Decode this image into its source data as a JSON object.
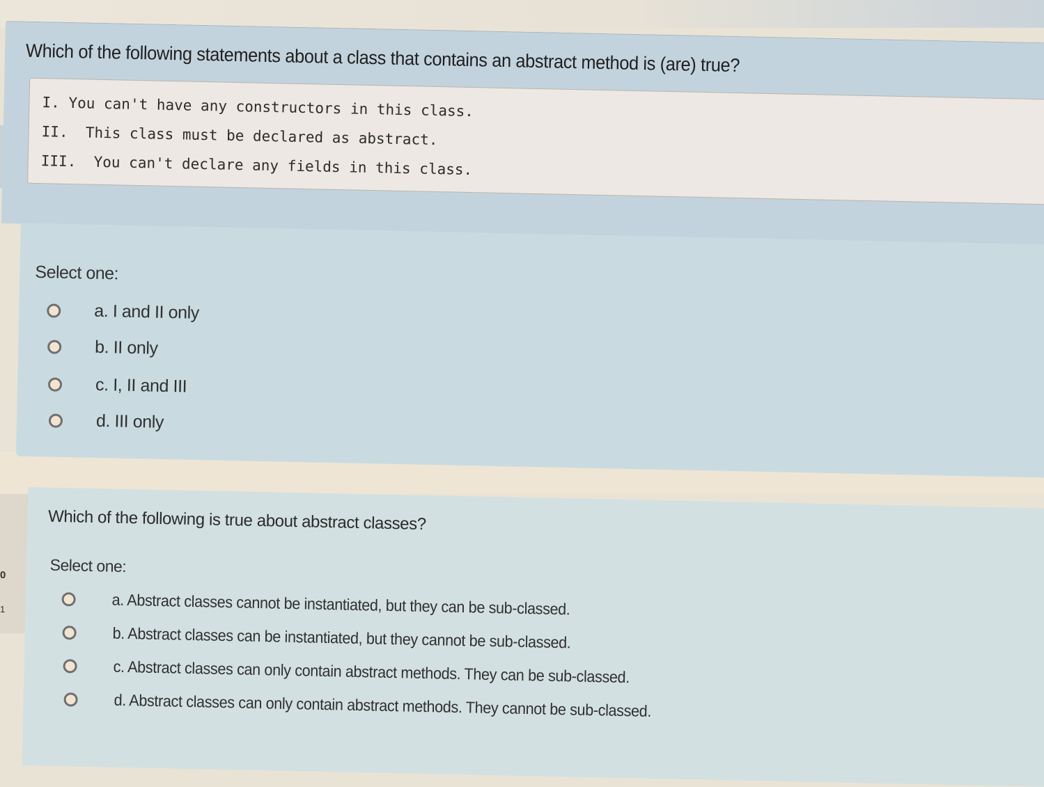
{
  "question1": {
    "prompt": "Which of the following statements about a class that contains an abstract method is (are) true?",
    "statements": [
      "I. You can't have any constructors in this class.",
      "II.  This class must be declared as abstract.",
      "III.  You can't declare any fields in this class."
    ],
    "select_label": "Select one:",
    "options": [
      {
        "label": "a. I and II only",
        "selected": false
      },
      {
        "label": "b. II only",
        "selected": false
      },
      {
        "label": "c. I, II and III",
        "selected": false
      },
      {
        "label": "d. III only",
        "selected": false
      }
    ]
  },
  "question2": {
    "prompt": "Which of the following is true about abstract classes?",
    "select_label": "Select one:",
    "options": [
      {
        "label": "a. Abstract classes cannot be instantiated, but they can be sub-classed.",
        "selected": false
      },
      {
        "label": "b. Abstract classes can be instantiated, but they cannot be sub-classed.",
        "selected": false
      },
      {
        "label": "c. Abstract classes can only contain abstract methods. They can be sub-classed.",
        "selected": false
      },
      {
        "label": "d. Abstract classes can only contain abstract methods. They cannot be sub-classed.",
        "selected": false
      }
    ]
  },
  "sidebar": {
    "partial_text": "0",
    "partial_text2": "1"
  },
  "colors": {
    "question_header_bg": "#c3d3dd",
    "code_box_bg": "#ede8e3",
    "answer_area_bg": "#c9dbe0",
    "page_bg": "#e9e3d6"
  }
}
